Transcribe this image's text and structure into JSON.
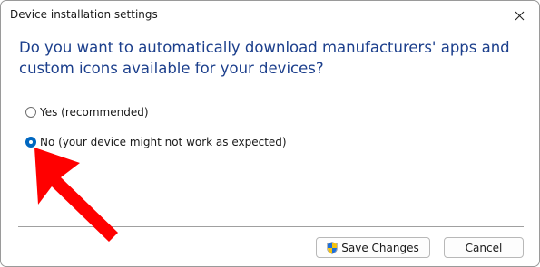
{
  "dialog": {
    "title": "Device installation settings",
    "question": "Do you want to automatically download manufacturers' apps and custom icons available for your devices?"
  },
  "options": [
    {
      "label": "Yes (recommended)",
      "selected": false
    },
    {
      "label": "No (your device might not work as expected)",
      "selected": true
    }
  ],
  "buttons": {
    "save_label": "Save Changes",
    "cancel_label": "Cancel"
  },
  "icons": {
    "close": "close-icon",
    "shield": "uac-shield-icon",
    "annotation": "red-arrow-icon"
  },
  "colors": {
    "question_text": "#1c3f8c",
    "radio_selected": "#0067c0",
    "annotation_arrow": "#ff0000"
  }
}
